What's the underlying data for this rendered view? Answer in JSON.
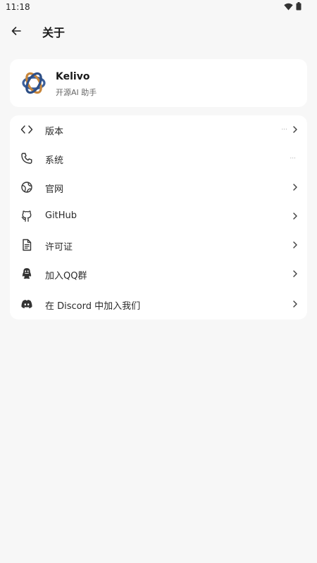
{
  "status_bar": {
    "time": "11:18"
  },
  "header": {
    "title": "关于"
  },
  "app_info": {
    "name": "Kelivo",
    "description": "开源AI 助手"
  },
  "menu": {
    "items": [
      {
        "label": "版本",
        "value": "...",
        "icon": "code-icon"
      },
      {
        "label": "系统",
        "value": "...",
        "icon": "phone-icon"
      },
      {
        "label": "官网",
        "icon": "globe-icon"
      },
      {
        "label": "GitHub",
        "icon": "github-icon"
      },
      {
        "label": "许可证",
        "icon": "document-icon"
      },
      {
        "label": "加入QQ群",
        "icon": "qq-icon"
      },
      {
        "label": "在 Discord 中加入我们",
        "icon": "discord-icon"
      }
    ]
  },
  "colors": {
    "background": "#f7f7f7",
    "card": "#ffffff",
    "logo_blue": "#3a5f9c",
    "logo_orange": "#c8863a"
  }
}
